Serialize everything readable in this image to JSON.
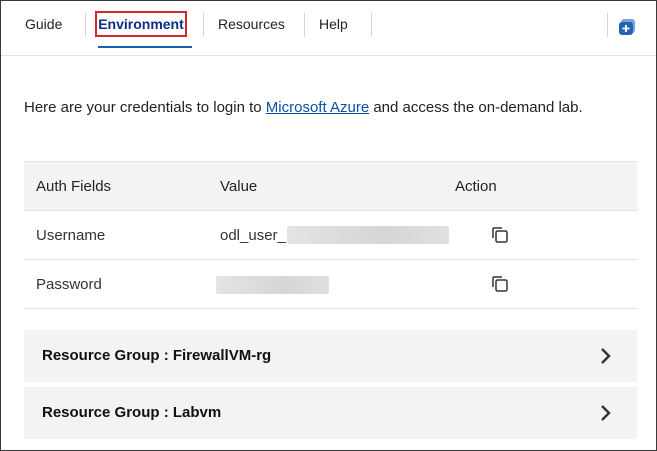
{
  "tabs": {
    "guide": "Guide",
    "environment": "Environment",
    "resources": "Resources",
    "help": "Help"
  },
  "header_icon": "cloud-lab-icon",
  "intro": {
    "before": "Here are your credentials to login to ",
    "link": "Microsoft Azure",
    "after": " and access the on-demand lab."
  },
  "credentials": {
    "headers": [
      "Auth Fields",
      "Value",
      "Action"
    ],
    "rows": [
      {
        "field": "Username",
        "value": "odl_user_",
        "action_icon": "copy-icon"
      },
      {
        "field": "Password",
        "value": "",
        "action_icon": "copy-icon"
      }
    ]
  },
  "resource_groups": [
    {
      "label": "Resource Group : FirewallVM-rg"
    },
    {
      "label": "Resource Group : Labvm"
    }
  ],
  "colors": {
    "accent": "#1a5fb4",
    "highlight_border": "#d9262b",
    "link": "#0a50a5",
    "panel": "#f3f3f3"
  }
}
